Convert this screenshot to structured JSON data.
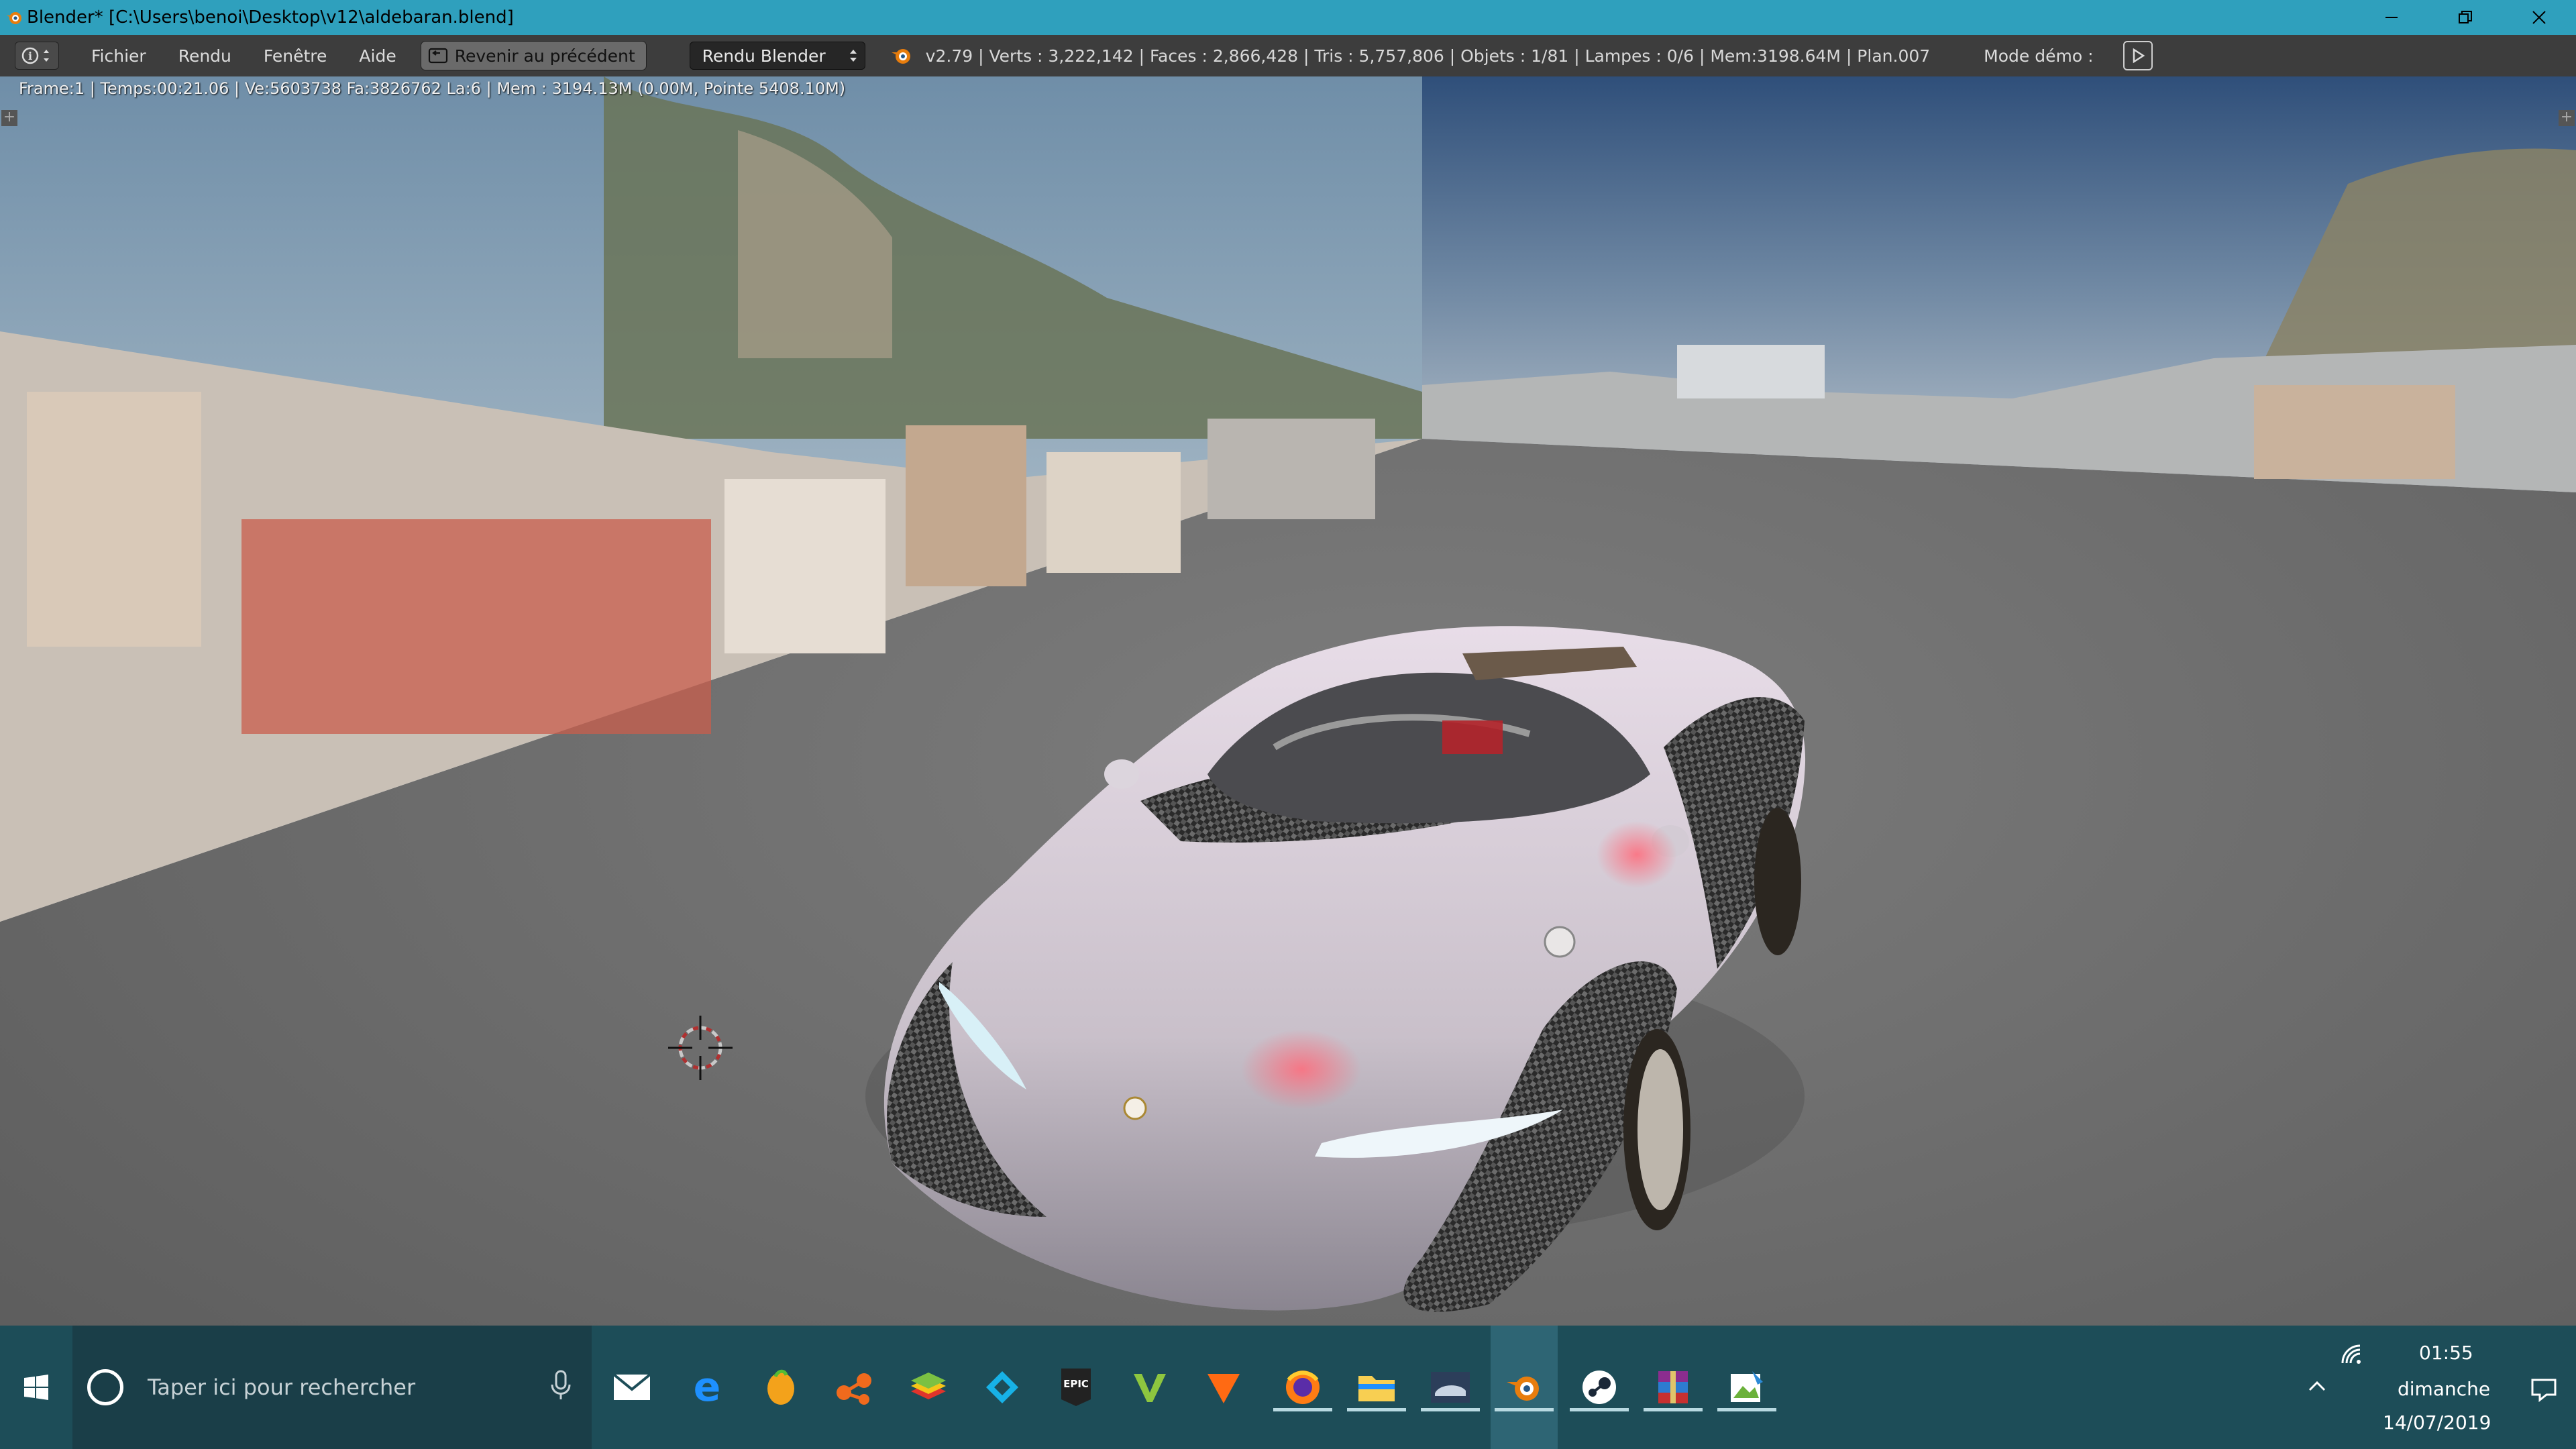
{
  "window": {
    "title": "Blender* [C:\\Users\\benoi\\Desktop\\v12\\aldebaran.blend]",
    "minimize_icon": "minimize-icon",
    "restore_icon": "restore-icon",
    "close_icon": "close-icon"
  },
  "header": {
    "editor_type_icon": "info-icon",
    "menus": [
      "Fichier",
      "Rendu",
      "Fenêtre",
      "Aide"
    ],
    "back_button": "Revenir au précédent",
    "render_engine": "Rendu Blender",
    "stats": "v2.79 | Verts  : 3,222,142 | Faces  : 2,866,428 | Tris  : 5,757,806 | Objets  : 1/81 | Lampes  : 0/6 | Mem:3198.64M | Plan.007",
    "mode_demo": "Mode démo  :"
  },
  "viewport": {
    "render_info": "Frame:1 | Temps:00:21.06 | Ve:5603738 Fa:3826762 La:6 | Mem  : 3194.13M (0.00M, Pointe 5408.10M)"
  },
  "taskbar": {
    "search_placeholder": "Taper ici pour rechercher",
    "apps": [
      "mail-icon",
      "edge-icon",
      "fl-studio-icon",
      "network-app-icon",
      "bluestacks-icon",
      "kodi-icon",
      "epic-games-icon",
      "gta-v-icon",
      "vlc-like-icon",
      "firefox-icon",
      "file-explorer-icon",
      "racing-game-icon",
      "blender-icon",
      "steam-icon",
      "winrar-icon",
      "image-editor-icon"
    ],
    "time": "01:55",
    "day": "dimanche",
    "date": "14/07/2019"
  },
  "colors": {
    "titlebar": "#2fa0bd",
    "header": "#3d3d3d",
    "taskbar": "#1d4d58",
    "floor": "#6a6a6a"
  }
}
